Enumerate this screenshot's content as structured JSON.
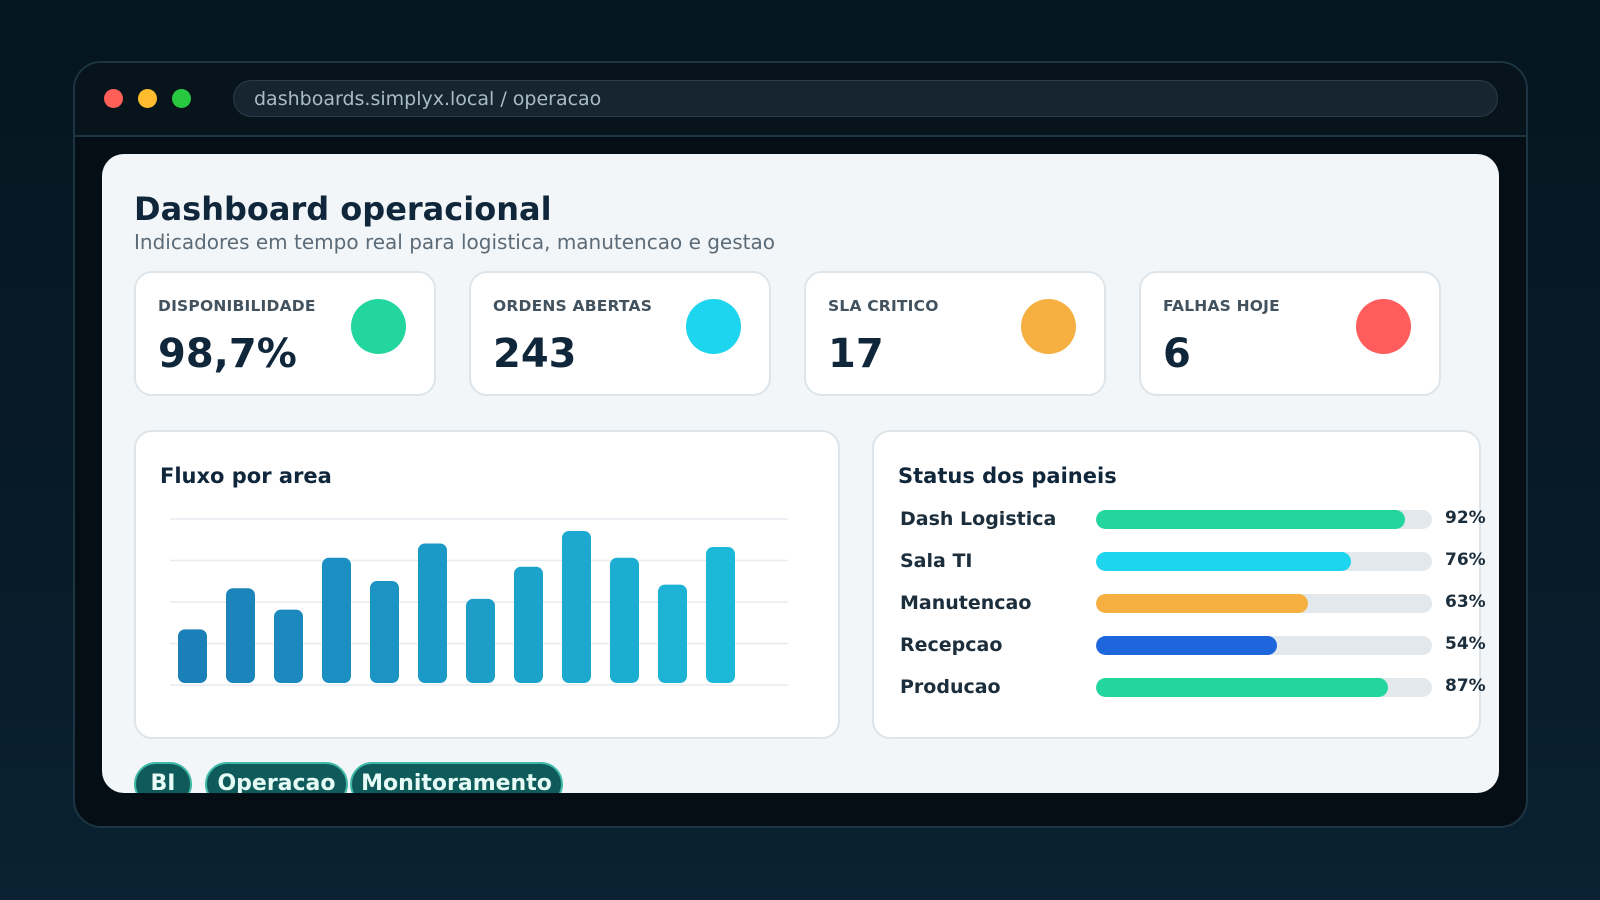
{
  "browser": {
    "url": "dashboards.simplyx.local / operacao"
  },
  "header": {
    "title": "Dashboard operacional",
    "subtitle": "Indicadores em tempo real para logistica, manutencao e gestao"
  },
  "kpis": [
    {
      "label": "DISPONIBILIDADE",
      "value": "98,7%",
      "color": "#22d69e"
    },
    {
      "label": "ORDENS ABERTAS",
      "value": "243",
      "color": "#1dd5ee"
    },
    {
      "label": "SLA CRITICO",
      "value": "17",
      "color": "#f5b041"
    },
    {
      "label": "FALHAS HOJE",
      "value": "6",
      "color": "#ff5d5d"
    }
  ],
  "flow_card": {
    "title": "Fluxo por area"
  },
  "chart_data": {
    "type": "bar",
    "values": [
      30,
      53,
      41,
      70,
      57,
      78,
      47,
      65,
      85,
      70,
      55,
      76
    ],
    "ylim": [
      0,
      90
    ],
    "grid": true,
    "colors": [
      "#1b7fb8",
      "#1cb8d8"
    ]
  },
  "status_card": {
    "title": "Status dos paineis",
    "rows": [
      {
        "label": "Dash Logistica",
        "percent": 92,
        "percent_label": "92%",
        "color": "#22d69e"
      },
      {
        "label": "Sala TI",
        "percent": 76,
        "percent_label": "76%",
        "color": "#1dd5ee"
      },
      {
        "label": "Manutencao",
        "percent": 63,
        "percent_label": "63%",
        "color": "#f5b041"
      },
      {
        "label": "Recepcao",
        "percent": 54,
        "percent_label": "54%",
        "color": "#1e66dc"
      },
      {
        "label": "Producao",
        "percent": 87,
        "percent_label": "87%",
        "color": "#22d69e"
      }
    ]
  },
  "tags": [
    "BI",
    "Operacao",
    "Monitoramento"
  ]
}
